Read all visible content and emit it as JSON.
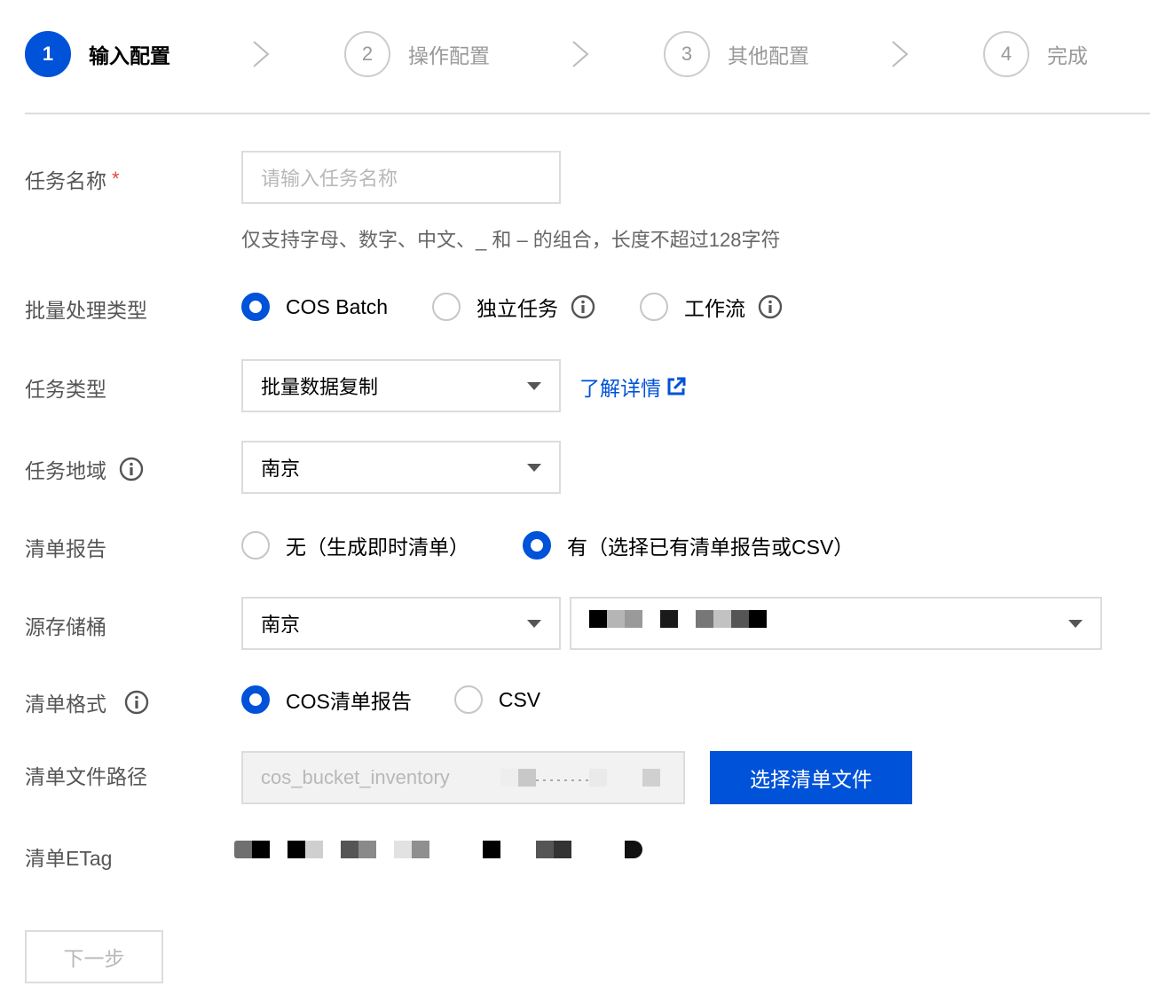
{
  "steps": [
    {
      "num": "1",
      "label": "输入配置"
    },
    {
      "num": "2",
      "label": "操作配置"
    },
    {
      "num": "3",
      "label": "其他配置"
    },
    {
      "num": "4",
      "label": "完成"
    }
  ],
  "form": {
    "task_name": {
      "label": "任务名称",
      "required_mark": "*",
      "placeholder": "请输入任务名称",
      "hint": "仅支持字母、数字、中文、_ 和 – 的组合，长度不超过128字符"
    },
    "batch_type": {
      "label": "批量处理类型",
      "options": [
        "COS Batch",
        "独立任务",
        "工作流"
      ],
      "selected": "COS Batch"
    },
    "task_type": {
      "label": "任务类型",
      "value": "批量数据复制",
      "link": "了解详情"
    },
    "task_region": {
      "label": "任务地域",
      "value": "南京"
    },
    "inventory_report": {
      "label": "清单报告",
      "options": [
        "无（生成即时清单）",
        "有（选择已有清单报告或CSV）"
      ],
      "selected": "有（选择已有清单报告或CSV）"
    },
    "source_bucket": {
      "label": "源存储桶",
      "region": "南京"
    },
    "inventory_format": {
      "label": "清单格式",
      "options": [
        "COS清单报告",
        "CSV"
      ],
      "selected": "COS清单报告"
    },
    "inventory_path": {
      "label": "清单文件路径",
      "value": "cos_bucket_inventory",
      "button": "选择清单文件"
    },
    "inventory_etag": {
      "label": "清单ETag"
    }
  },
  "footer": {
    "next_label": "下一步"
  },
  "colors": {
    "primary": "#0052d9",
    "required": "#e54545",
    "border": "#dcdcdc"
  }
}
